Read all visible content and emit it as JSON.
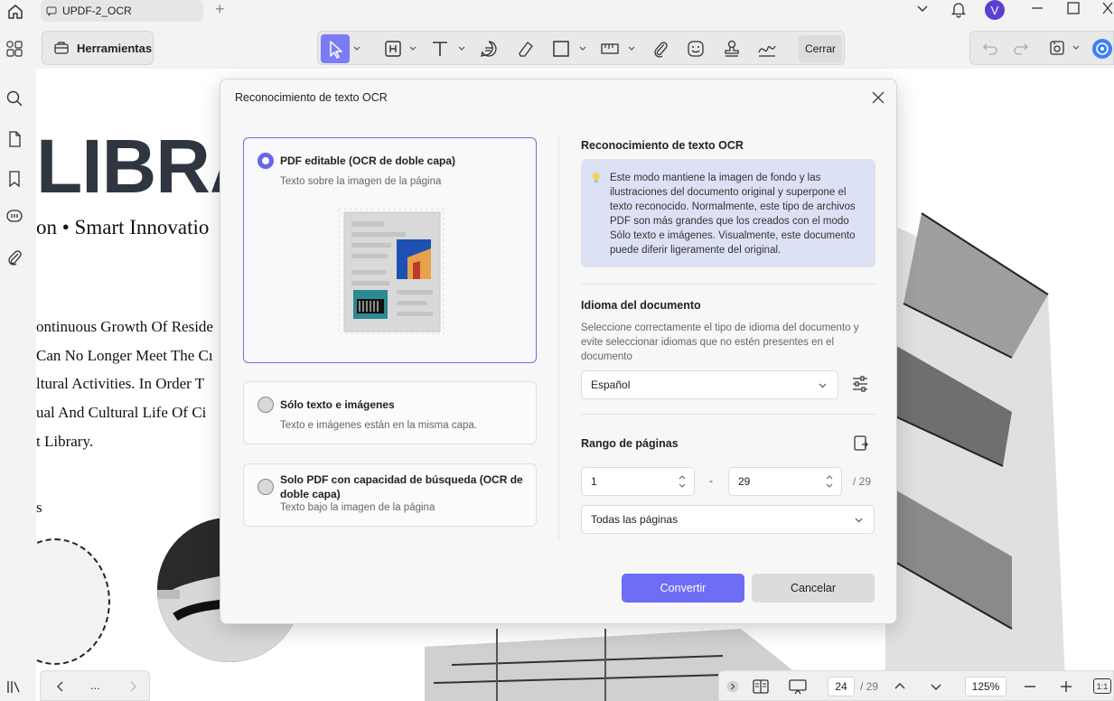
{
  "titlebar": {
    "tab_title": "UPDF-2_OCR",
    "tab_add": "+",
    "avatar_letter": "V"
  },
  "toolbar": {
    "tools_label": "Herramientas",
    "close_label": "Cerrar"
  },
  "document": {
    "title": "LIBRA",
    "subtitle": "on • Smart Innovatio",
    "lines": [
      "ontinuous Growth Of Reside",
      "Can No Longer Meet The Cı",
      "ltural Activities. In Order T",
      "ual And Cultural Life Of Ci",
      "t Library."
    ],
    "stray_letter": "s"
  },
  "dialog": {
    "title": "Reconocimiento de texto OCR",
    "options": [
      {
        "title": "PDF editable (OCR de doble capa)",
        "desc": "Texto sobre la imagen de la página",
        "selected": true
      },
      {
        "title": "Sólo texto e imágenes",
        "desc": "Texto e imágenes están en la misma capa.",
        "selected": false
      },
      {
        "title": "Solo PDF con capacidad de búsqueda (OCR de doble capa)",
        "desc": "Texto bajo la imagen de la página",
        "selected": false
      }
    ],
    "right_title": "Reconocimiento de texto OCR",
    "info": "Este modo mantiene la imagen de fondo y las ilustraciones del documento original y superpone el texto reconocido. Normalmente, este tipo de archivos PDF son más grandes que los creados con el modo Sólo texto e imágenes. Visualmente, este documento puede diferir ligeramente del original.",
    "language_title": "Idioma del documento",
    "language_desc": "Seleccione correctamente el tipo de idioma del documento y evite seleccionar idiomas que no estén presentes en el documento",
    "language_value": "Español",
    "range_title": "Rango de páginas",
    "range_from": "1",
    "range_dash": "-",
    "range_to": "29",
    "range_total": "/ 29",
    "range_mode": "Todas las páginas",
    "convert_label": "Convertir",
    "cancel_label": "Cancelar"
  },
  "bottom": {
    "more": "...",
    "page": "24",
    "page_total": "/ 29",
    "zoom": "125%",
    "fit_label": "1:1"
  },
  "colors": {
    "accent": "#6d6df5",
    "info_bg": "#dde1f5"
  }
}
